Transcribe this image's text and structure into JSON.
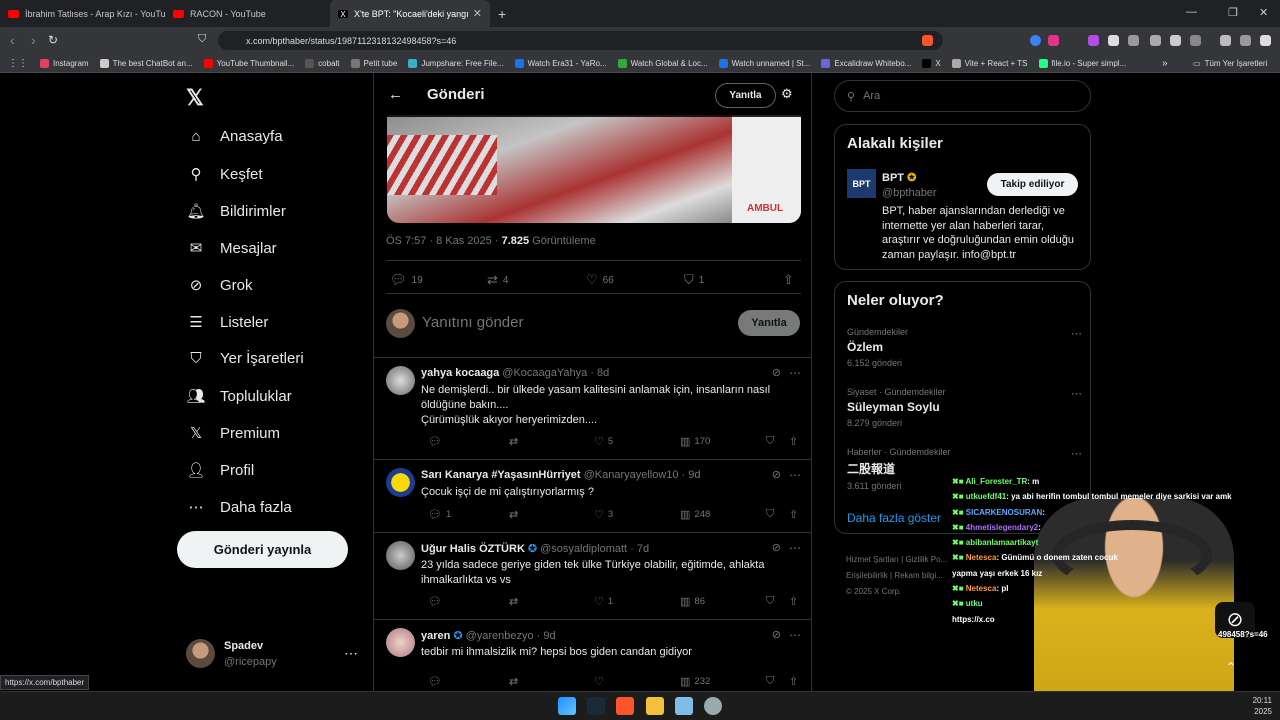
{
  "browser": {
    "tabs": [
      {
        "title": "İbrahim Tatlıses - Arap Kızı - YouTube",
        "color": "#ff0000"
      },
      {
        "title": "RACON - YouTube",
        "color": "#ff0000"
      },
      {
        "title": "X'te BPT: \"Kocaeli'deki yangında",
        "color": "#ffffff",
        "active": true
      }
    ],
    "url": "x.com/bpthaber/status/1987112318132498458?s=46",
    "bookmarks": [
      "Instagram",
      "The best ChatBot an...",
      "YouTube Thumbnail...",
      "cobalt",
      "Petit tube",
      "Jumpshare: Free File...",
      "Watch Era31 - YaRo...",
      "Watch Global & Loc...",
      "Watch unnamed | St...",
      "Excalidraw Whitebo...",
      "X",
      "Vite + React + TS",
      "file.io - Super simpl..."
    ],
    "bookmarks_more": "»",
    "all_bookmarks": "Tüm Yer İşaretleri"
  },
  "nav": {
    "items": [
      {
        "label": "Anasayfa",
        "icon": "home-icon",
        "glyph": "⌂"
      },
      {
        "label": "Keşfet",
        "icon": "search-icon",
        "glyph": "⚲"
      },
      {
        "label": "Bildirimler",
        "icon": "bell-icon",
        "glyph": "🔔︎"
      },
      {
        "label": "Mesajlar",
        "icon": "mail-icon",
        "glyph": "✉"
      },
      {
        "label": "Grok",
        "icon": "grok-icon",
        "glyph": "⊘"
      },
      {
        "label": "Listeler",
        "icon": "list-icon",
        "glyph": "☰"
      },
      {
        "label": "Yer İşaretleri",
        "icon": "bookmark-icon",
        "glyph": "⛉"
      },
      {
        "label": "Topluluklar",
        "icon": "communities-icon",
        "glyph": "👥︎"
      },
      {
        "label": "Premium",
        "icon": "x-logo-icon",
        "glyph": "𝕏"
      },
      {
        "label": "Profil",
        "icon": "profile-icon",
        "glyph": "👤︎"
      },
      {
        "label": "Daha fazla",
        "icon": "more-circle-icon",
        "glyph": "⋯"
      }
    ],
    "post_button": "Gönderi yayınla",
    "account": {
      "name": "Spadev",
      "handle": "@ricepapy"
    }
  },
  "main": {
    "title": "Gönderi",
    "reply_label": "Yanıtla",
    "meta": {
      "time": "ÖS 7:57 · 8 Kas 2025 ·",
      "views": "7.825",
      "views_label": "Görüntüleme"
    },
    "actions": {
      "replies": "19",
      "reposts": "4",
      "likes": "66",
      "bookmarks": "1"
    },
    "composer": {
      "placeholder": "Yanıtını gönder",
      "button": "Yanıtla"
    },
    "replies": [
      {
        "name": "yahya kocaaga",
        "handle": "@KocaagaYahya · 8d",
        "text": "Ne demişlerdi.. bir ülkede yasam kalitesini anlamak için, insanların nasıl öldüğüne bakın....\nÇürümüşlük akıyor heryerimizden....",
        "replies": "",
        "reposts": "",
        "likes": "5",
        "views": "170"
      },
      {
        "name": "Sarı Kanarya #YaşasınHürriyet",
        "handle": "@Kanaryayellow10 · 9d",
        "text": "Çocuk işçi de mi çalıştırıyorlarmış ?",
        "replies": "1",
        "reposts": "",
        "likes": "3",
        "views": "248"
      },
      {
        "name": "Uğur Halis ÖZTÜRK",
        "handle": "@sosyaldiplomatt · 7d",
        "text": "23 yılda sadece geriye giden tek ülke Türkiye olabilir, eğitimde, ahlakta ihmalkarlıkta vs vs",
        "replies": "",
        "reposts": "",
        "likes": "1",
        "views": "86"
      },
      {
        "name": "yaren",
        "handle": "@yarenbezyo · 9d",
        "text": "tedbir mi ihmalsizlik mi? hepsi bos giden candan gidiyor",
        "replies": "",
        "reposts": "",
        "likes": "",
        "views": "232"
      }
    ]
  },
  "right": {
    "search_placeholder": "Ara",
    "related": {
      "title": "Alakalı kişiler",
      "name": "BPT",
      "handle": "@bpthaber",
      "follow": "Takip ediliyor",
      "bio": "BPT, haber ajanslarından derlediği ve internette yer alan haberleri tarar, araştırır ve doğruluğundan emin olduğu zaman paylaşır. info@bpt.tr"
    },
    "trends": {
      "title": "Neler oluyor?",
      "items": [
        {
          "cat": "Gündemdekiler",
          "name": "Özlem",
          "count": "6.152 gönderi"
        },
        {
          "cat": "Siyaset · Gündemdekiler",
          "name": "Süleyman Soylu",
          "count": "8.279 gönderi"
        },
        {
          "cat": "Haberler · Gündemdekiler",
          "name": "二股報道",
          "count": "3.611 gönderi"
        }
      ],
      "more": "Daha fazla göster"
    },
    "footer": [
      "Hizmet Şartları",
      "Gizlilik Po...",
      "Erişilebilirlik",
      "Rekam bilgi...",
      "© 2025 X Corp."
    ]
  },
  "overlay": {
    "chat": [
      {
        "user": "Ali_Forester_TR",
        "msg": ": m",
        "color": "#6cff6c"
      },
      {
        "user": "utkuefdf41",
        "msg": ": ya abi herifin tombul tombul memeler diye sarkisi var amk",
        "color": "#6cff6c"
      },
      {
        "user": "SICARKENOSURAN",
        "msg": ":",
        "color": "#5aa9ff"
      },
      {
        "user": "4hmetislegendary2",
        "msg": ":",
        "color": "#b06cff"
      },
      {
        "user": "abibanlamaartikayt",
        "msg": "",
        "color": "#6cff6c"
      },
      {
        "user": "Netesca",
        "msg": ": Günümü    o donem zaten cocuk",
        "color": "#ff9a3c"
      },
      {
        "user": "",
        "msg": "yapma yaşı erkek 16 kız",
        "color": "#ffffff"
      },
      {
        "user": "Netesca",
        "msg": ": pl",
        "color": "#ff9a3c"
      },
      {
        "user": "utku",
        "msg": "",
        "color": "#6cff6c"
      },
      {
        "user": "",
        "msg": "https://x.co",
        "color": "#ffffff"
      }
    ],
    "url_fragment": "498458?s=46"
  },
  "status_bar": "https://x.com/bpthaber",
  "clock": {
    "time": "20:11",
    "date": "2025"
  }
}
